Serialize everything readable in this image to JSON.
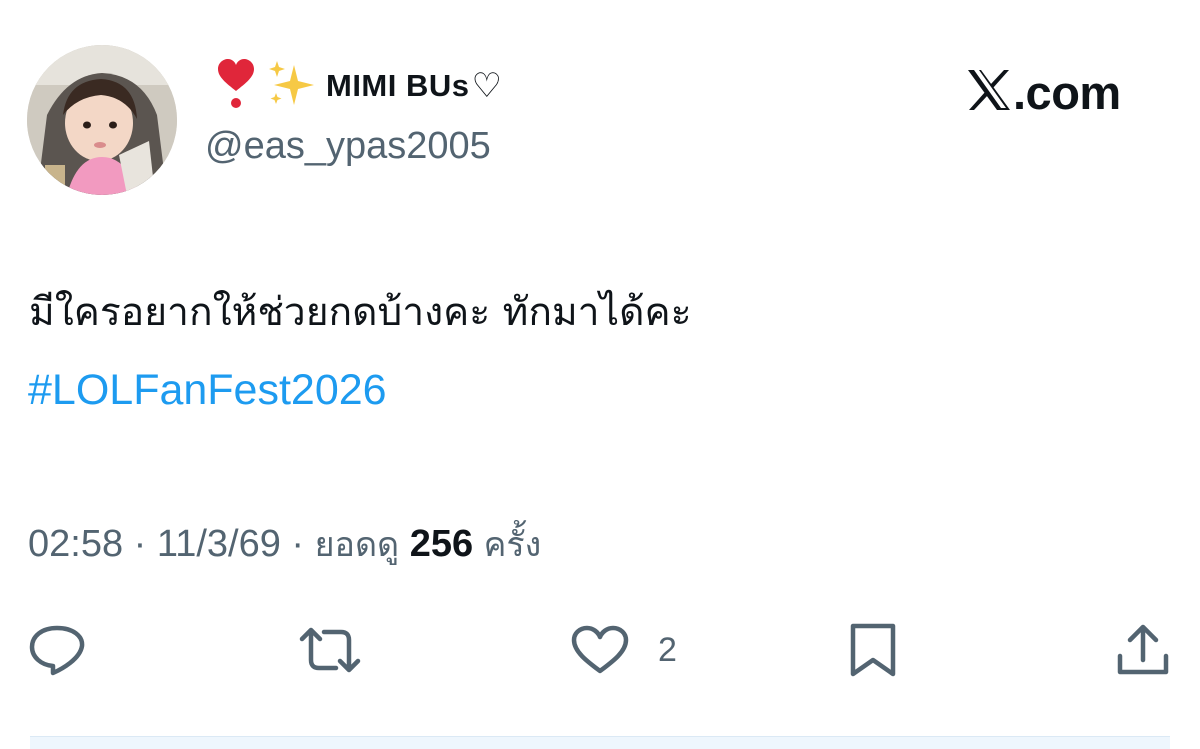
{
  "author": {
    "name_emoji": [
      "heart-exclamation",
      "sparkles"
    ],
    "display_name": "MIMI BUs",
    "name_suffix": "♡",
    "handle": "@eas_ypas2005",
    "avatar": "child-photo"
  },
  "brand": {
    "logo": "x-logo",
    "text": ".com"
  },
  "tweet": {
    "text": "มีใครอยากให้ช่วยกดบ้างคะ ทักมาได้คะ",
    "hashtag": "#LOLFanFest2026"
  },
  "meta": {
    "time": "02:58",
    "separator_1": " · ",
    "date": "11/3/69",
    "separator_2": " · ",
    "views_label": "ยอดดู",
    "views_count": "256",
    "views_unit": "ครั้ง"
  },
  "actions": {
    "reply": {
      "icon": "reply-icon"
    },
    "retweet": {
      "icon": "retweet-icon"
    },
    "like": {
      "icon": "heart-icon",
      "count": "2"
    },
    "bookmark": {
      "icon": "bookmark-icon"
    },
    "share": {
      "icon": "share-icon"
    }
  },
  "colors": {
    "text_primary": "#0f1419",
    "text_secondary": "#536471",
    "link": "#1d9bf0",
    "heart_red": "#e0263a",
    "sparkle_gold": "#f6c945"
  }
}
